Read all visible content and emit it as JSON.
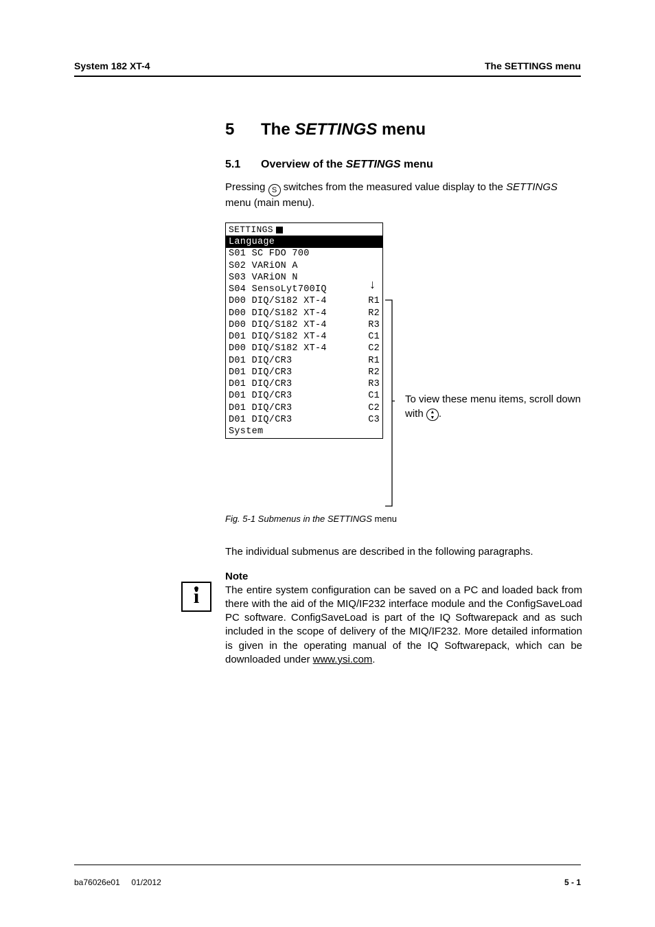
{
  "header": {
    "left": "System 182 XT-4",
    "right": "The SETTINGS menu"
  },
  "h1": {
    "num": "5",
    "pre": "The ",
    "ital": "SETTINGS",
    "post": " menu"
  },
  "h2": {
    "num": "5.1",
    "pre": "Overview of the ",
    "ital": "SETTINGS",
    "post": " menu"
  },
  "intro": {
    "a": "Pressing ",
    "s": "S",
    "b": " switches from the measured value display to the ",
    "ital": "SETTINGS",
    "c": " menu (main menu)."
  },
  "lcd": {
    "title": "SETTINGS",
    "selected": "Language",
    "rows": [
      {
        "l": "S01 SC FDO 700",
        "r": ""
      },
      {
        "l": "S02 VARiON A",
        "r": ""
      },
      {
        "l": "S03 VARiON N",
        "r": ""
      },
      {
        "l": "S04 SensoLyt700IQ",
        "r": ""
      },
      {
        "l": "D00 DIQ/S182 XT-4",
        "r": "R1"
      },
      {
        "l": "D00 DIQ/S182 XT-4",
        "r": "R2"
      },
      {
        "l": "D00 DIQ/S182 XT-4",
        "r": "R3"
      },
      {
        "l": "D01 DIQ/S182 XT-4",
        "r": "C1"
      },
      {
        "l": "D00 DIQ/S182 XT-4",
        "r": "C2"
      },
      {
        "l": "D01 DIQ/CR3",
        "r": "R1"
      },
      {
        "l": "D01 DIQ/CR3",
        "r": "R2"
      },
      {
        "l": "D01 DIQ/CR3",
        "r": "R3"
      },
      {
        "l": "D01 DIQ/CR3",
        "r": "C1"
      },
      {
        "l": "D01 DIQ/CR3",
        "r": "C2"
      },
      {
        "l": "D01 DIQ/CR3",
        "r": "C3"
      },
      {
        "l": "System",
        "r": ""
      }
    ]
  },
  "annot": {
    "a": "To view these menu items, scroll down with ",
    "b": "."
  },
  "figcap": {
    "a": "Fig. 5-1    Submenus in the SETTINGS ",
    "b": "menu"
  },
  "afterfig": "The individual submenus are described in the following paragraphs.",
  "note": {
    "title": "Note",
    "body_a": "The entire system configuration can be saved on a PC and loaded back from there with the aid of the MIQ/IF232 interface module and the ConfigSaveLoad PC software. ConfigSaveLoad is part of the IQ Softwarepack and as such included in the scope of delivery of the MIQ/IF232. More detailed information is given in the operating manual of the IQ Softwarepack, which can be downloaded under ",
    "link": "www.ysi.com",
    "body_b": "."
  },
  "footer": {
    "left_a": "ba76026e01",
    "left_b": "01/2012",
    "right": "5 - 1"
  }
}
